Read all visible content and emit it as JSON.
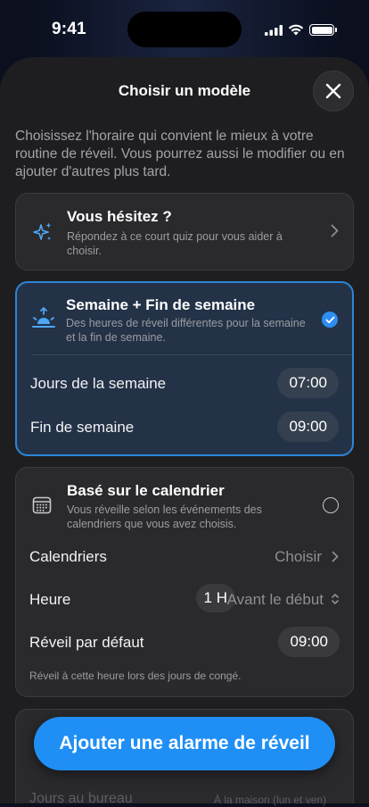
{
  "status": {
    "time": "9:41"
  },
  "sheet": {
    "title": "Choisir un modèle",
    "intro": "Choisissez l'horaire qui convient le mieux à votre routine de réveil. Vous pourrez aussi le modifier ou en ajouter d'autres plus tard."
  },
  "quiz": {
    "title": "Vous hésitez ?",
    "subtitle": "Répondez à ce court quiz pour vous aider à choisir."
  },
  "weekend": {
    "title": "Semaine + Fin de semaine",
    "subtitle": "Des heures de réveil différentes pour la semaine et la fin de semaine.",
    "selected": true,
    "rows": [
      {
        "label": "Jours de la semaine",
        "value": "07:00"
      },
      {
        "label": "Fin de semaine",
        "value": "09:00"
      }
    ]
  },
  "calendar": {
    "title": "Basé sur le calendrier",
    "subtitle": "Vous réveille selon les événements des calendriers que vous avez choisis.",
    "calendars_label": "Calendriers",
    "calendars_value": "Choisir",
    "time_label": "Heure",
    "time_offset": "1 H",
    "time_relation": "Avant le début",
    "default_label": "Réveil par défaut",
    "default_value": "09:00",
    "footnote": "Réveil à cette heure lors des jours de congé."
  },
  "peek": {
    "label": "Jours au bureau",
    "value": "À la maison (lun et ven)"
  },
  "cta": {
    "label": "Ajouter une alarme de réveil"
  },
  "colors": {
    "accent": "#1f8ff5",
    "selected_border": "#2d84d6",
    "sheet": "#1e1e20"
  }
}
